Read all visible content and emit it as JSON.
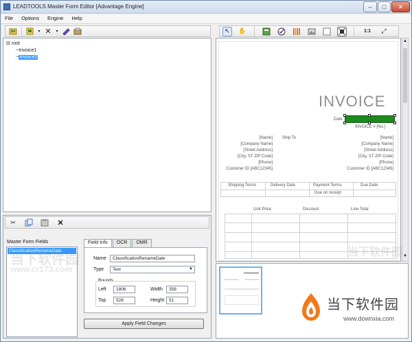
{
  "window": {
    "title": "LEADTOOLS Master Form Editor [Advantage Engine]",
    "controls": {
      "minimize": "‒",
      "maximize": "□",
      "close": "✕"
    }
  },
  "menu": [
    "File",
    "Options",
    "Engine",
    "Help"
  ],
  "left_toolbar": {
    "icons": [
      "open-folder-icon",
      "new-form-icon",
      "delete-icon",
      "edit-icon",
      "properties-icon"
    ]
  },
  "tree": {
    "root": "root",
    "children": [
      "Invoice1",
      "Invoice2"
    ],
    "selected": "Invoice2"
  },
  "canvas_toolbar": {
    "icons": [
      "select-pointer-icon",
      "pan-hand-icon",
      "add-field-icon",
      "check-icon",
      "barcode-icon",
      "image-icon",
      "rectangle-icon",
      "fit-icon"
    ],
    "zoom_actual": "1:1",
    "fit_symbol": "⤢"
  },
  "invoice": {
    "title": "INVOICE",
    "date_label": "Date",
    "number_label": "INVOICE # [No.]",
    "bill_to": [
      "[Name]",
      "[Company Name]",
      "[Street Address]",
      "[City, ST ZIP Code]",
      "[Phone]",
      "Customer ID [ABC12345]"
    ],
    "ship_to_label": "Ship To",
    "ship_to": [
      "[Name]",
      "[Company Name]",
      "[Street Address]",
      "[City, ST ZIP Code]",
      "[Phone]",
      "Customer ID [ABC12345]"
    ],
    "terms_headers": [
      "Shipping Terms",
      "Delivery Date",
      "Payment Terms",
      "Due Date"
    ],
    "terms_values": [
      "",
      "",
      "Due on receipt",
      ""
    ],
    "line_headers": [
      "Unit Price",
      "Discount",
      "Line Total"
    ]
  },
  "bottom_toolbar": {
    "icons": [
      "cut-icon",
      "copy-icon",
      "paste-icon",
      "delete-icon"
    ]
  },
  "fields_panel": {
    "label": "Master Form Fields",
    "items": [
      "ClassificationRenameDate"
    ],
    "selected": "ClassificationRenameDate"
  },
  "tabs": [
    "Field Info",
    "OCR",
    "OMR"
  ],
  "active_tab": "Field Info",
  "field_info": {
    "name_label": "Name",
    "name_value": "ClassificationRenameDate",
    "type_label": "Type",
    "type_value": "Text",
    "bounds_label": "Bounds",
    "left_label": "Left",
    "left_value": "1806",
    "width_label": "Width",
    "width_value": "358",
    "top_label": "Top",
    "top_value": "528",
    "height_label": "Height",
    "height_value": "51",
    "apply_button": "Apply Field Changes"
  },
  "watermark": {
    "brand": "当下软件园",
    "url": "www.downxia.com",
    "faint_left_1": "当下软件园",
    "faint_left_2": "www.cr173.com",
    "faint_right": "当下软件园"
  }
}
